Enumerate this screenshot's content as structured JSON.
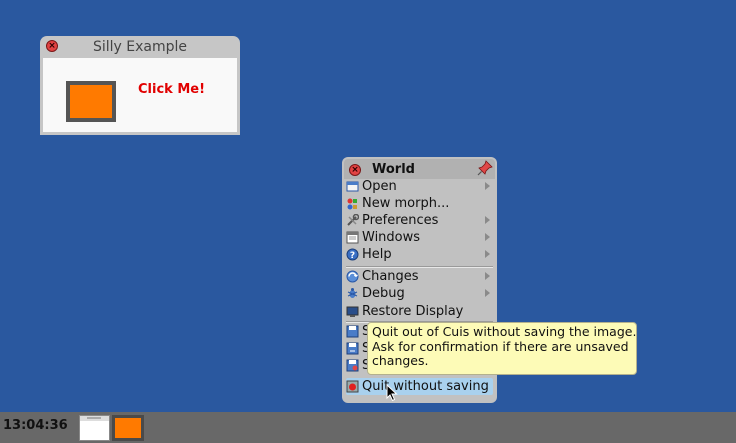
{
  "colors": {
    "desktop": "#2a589f",
    "menu_bg": "#c1c1c1",
    "tooltip_bg": "#fdfbb7",
    "accent_orange": "#ff7a00",
    "click_me_red": "#e10000",
    "highlight": "#a9d1ee"
  },
  "silly_window": {
    "title": "Silly Example",
    "button_label": "Click Me!"
  },
  "world_menu": {
    "title": "World",
    "items": [
      {
        "label": "Open",
        "icon": "open-folder-icon",
        "submenu": true
      },
      {
        "label": "New morph...",
        "icon": "new-morph-icon",
        "submenu": false
      },
      {
        "label": "Preferences",
        "icon": "preferences-icon",
        "submenu": true
      },
      {
        "label": "Windows",
        "icon": "windows-icon",
        "submenu": true
      },
      {
        "label": "Help",
        "icon": "help-icon",
        "submenu": true
      },
      {
        "label": "Changes",
        "icon": "changes-icon",
        "submenu": true
      },
      {
        "label": "Debug",
        "icon": "debug-icon",
        "submenu": true
      },
      {
        "label": "Restore Display",
        "icon": "display-icon",
        "submenu": false
      },
      {
        "label": "S",
        "icon": "save-icon",
        "submenu": false
      },
      {
        "label": "S",
        "icon": "save-as-icon",
        "submenu": false
      },
      {
        "label": "S",
        "icon": "save-quit-icon",
        "submenu": false
      },
      {
        "label": "Quit without saving",
        "icon": "quit-icon",
        "submenu": false
      }
    ]
  },
  "tooltip": {
    "line1": "Quit out of Cuis without saving the image.",
    "line2": "Ask for confirmation if there are unsaved",
    "line3": "changes."
  },
  "taskbar": {
    "clock": "13:04:36"
  }
}
